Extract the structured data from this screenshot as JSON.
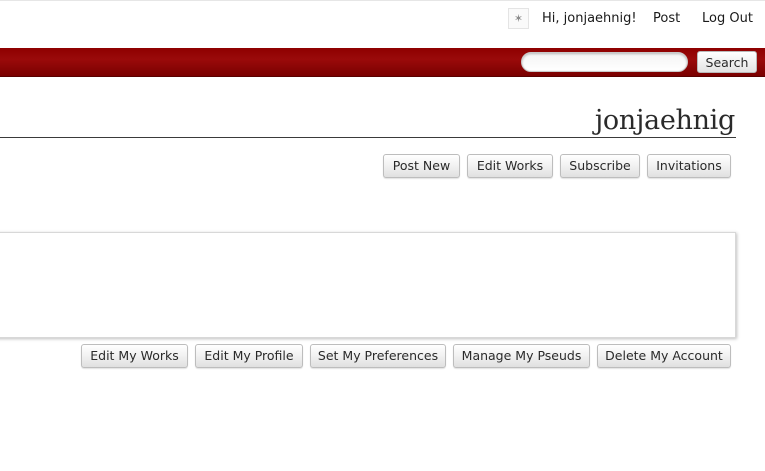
{
  "userbar": {
    "avatar_icon": "user-avatar-icon",
    "greeting": "Hi, jonjaehnig!",
    "post_label": "Post",
    "logout_label": "Log Out"
  },
  "header": {
    "accent_color": "#8e0000",
    "search_placeholder": "",
    "search_value": "",
    "search_button_label": "Search"
  },
  "page": {
    "title": "jonjaehnig"
  },
  "actions": {
    "post_new": "Post New",
    "edit_works": "Edit Works",
    "subscribe": "Subscribe",
    "invitations": "Invitations"
  },
  "account_actions": {
    "edit_my_works": "Edit My Works",
    "edit_my_profile": "Edit My Profile",
    "set_my_preferences": "Set My Preferences",
    "manage_my_pseuds": "Manage My Pseuds",
    "delete_my_account": "Delete My Account"
  }
}
